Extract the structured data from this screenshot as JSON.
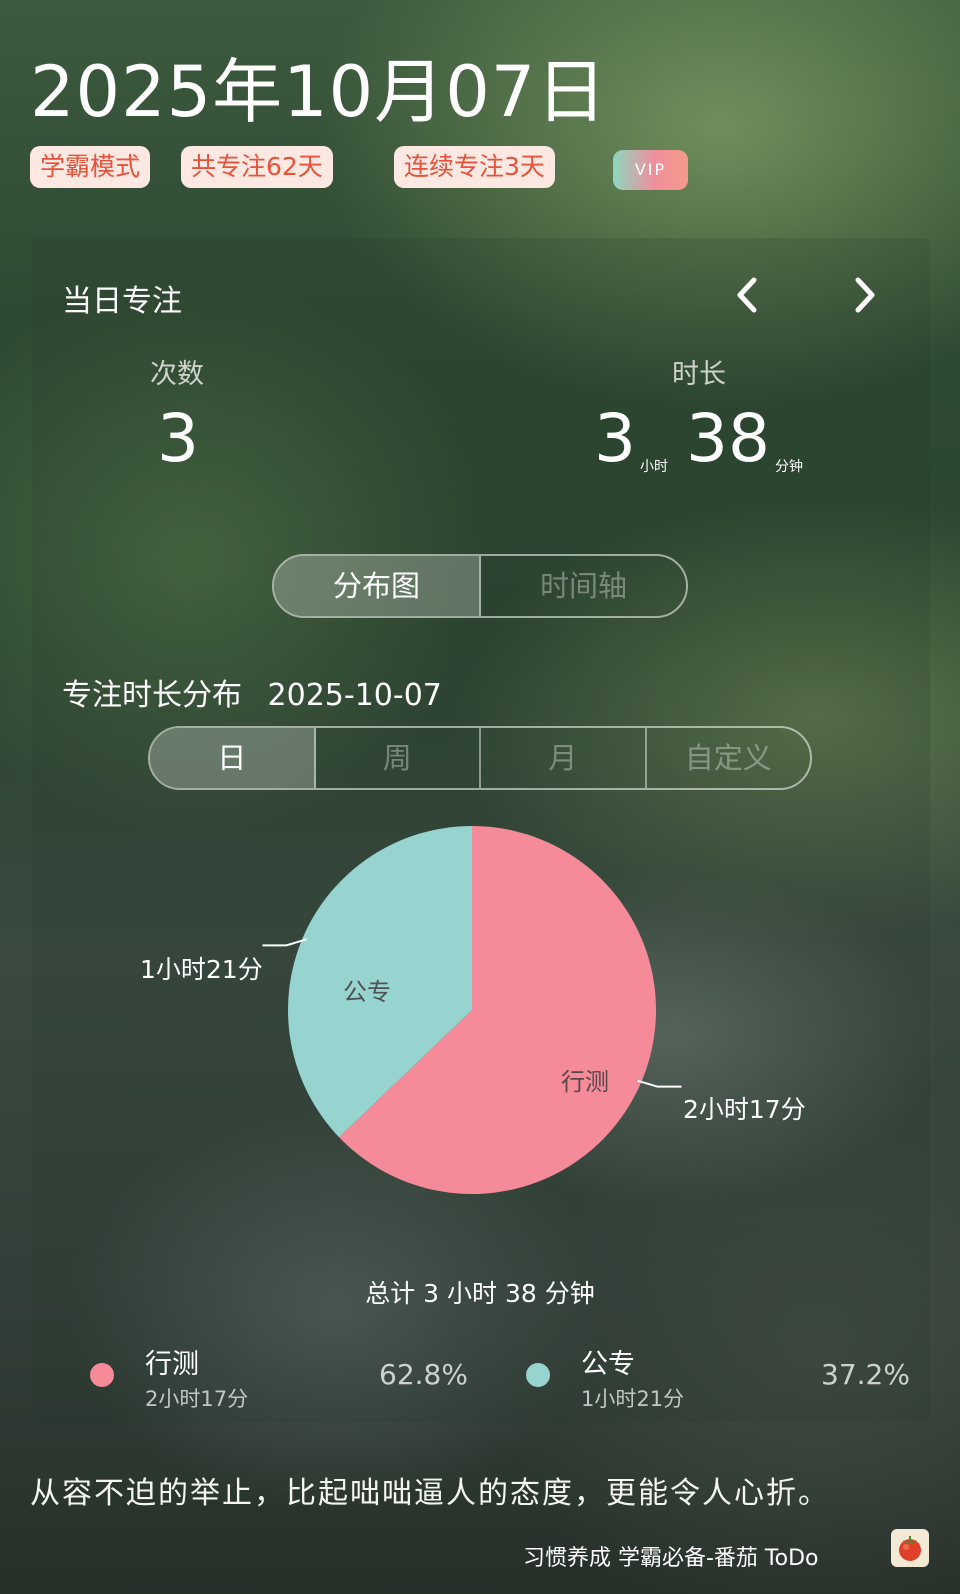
{
  "header": {
    "date": "2025年10月07日",
    "tags": [
      "学霸模式",
      "共专注62天",
      "连续专注3天"
    ],
    "vip_label": "VIP"
  },
  "daily": {
    "title": "当日专注",
    "count_label": "次数",
    "count_value": "3",
    "duration_label": "时长",
    "hours_value": "3",
    "hours_unit": "小时",
    "minutes_value": "38",
    "minutes_unit": "分钟"
  },
  "view_toggle": {
    "options": [
      "分布图",
      "时间轴"
    ],
    "selected": "分布图"
  },
  "distribution": {
    "title": "专注时长分布",
    "date": "2025-10-07",
    "range_tabs": [
      "日",
      "周",
      "月",
      "自定义"
    ],
    "selected_range": "日",
    "total_text": "总计 3 小时 38 分钟"
  },
  "chart_data": {
    "type": "pie",
    "slices": [
      {
        "name": "行测",
        "value_minutes": 137,
        "duration_text": "2小时17分",
        "percent_text": "62.8%",
        "color": "#f58a99"
      },
      {
        "name": "公专",
        "value_minutes": 81,
        "duration_text": "1小时21分",
        "percent_text": "37.2%",
        "color": "#97d3cf"
      }
    ]
  },
  "quote": "从容不迫的举止，比起咄咄逼人的态度，更能令人心折。",
  "footer": {
    "text": "习惯养成 学霸必备-番茄 ToDo",
    "icon": "tomato-icon"
  }
}
